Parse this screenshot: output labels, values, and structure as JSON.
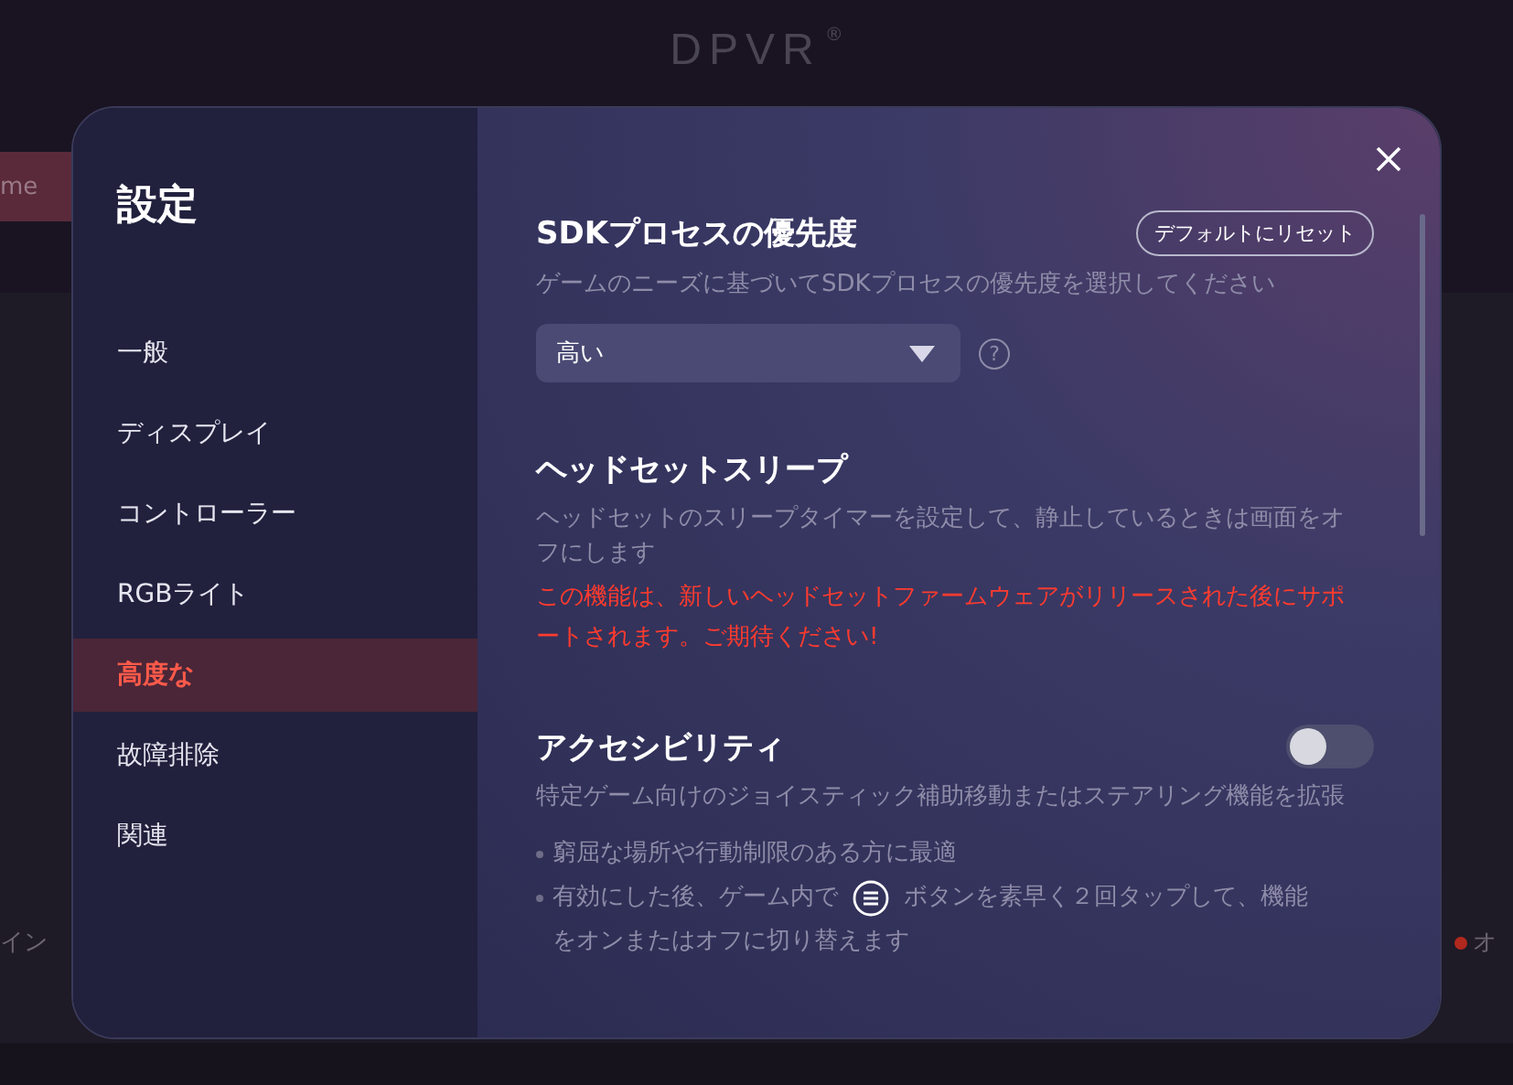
{
  "background": {
    "logo": "DPVR",
    "logo_mark": "®",
    "left_button": "me",
    "left_label": "イン",
    "right_label": "オ"
  },
  "sidebar": {
    "title": "設定",
    "items": [
      {
        "label": "一般",
        "selected": false
      },
      {
        "label": "ディスプレイ",
        "selected": false
      },
      {
        "label": "コントローラー",
        "selected": false
      },
      {
        "label": "RGBライト",
        "selected": false
      },
      {
        "label": "高度な",
        "selected": true
      },
      {
        "label": "故障排除",
        "selected": false
      },
      {
        "label": "関連",
        "selected": false
      }
    ]
  },
  "sections": [
    {
      "kind": "select",
      "title": "SDKプロセスの優先度",
      "reset_button": "デフォルトにリセット",
      "description": "ゲームのニーズに基づいてSDKプロセスの優先度を選択してください",
      "value": "高い",
      "help": "?"
    },
    {
      "kind": "notice",
      "title": "ヘッドセットスリープ",
      "description": "ヘッドセットのスリープタイマーを設定して、静止しているときは画面をオフにします",
      "warning": "この機能は、新しいヘッドセットファームウェアがリリースされた後にサポートされます。ご期待ください!"
    },
    {
      "kind": "toggle",
      "title": "アクセシビリティ",
      "on": false,
      "description": "特定ゲーム向けのジョイスティック補助移動またはステアリング機能を拡張",
      "bullets": [
        {
          "text": "窮屈な場所や行動制限のある方に最適"
        },
        {
          "text": "有効にした後、ゲーム内で",
          "text_after": "ボタンを素早く２回タップして、機能",
          "text_line2": "をオンまたはオフに切り替えます"
        }
      ]
    }
  ]
}
